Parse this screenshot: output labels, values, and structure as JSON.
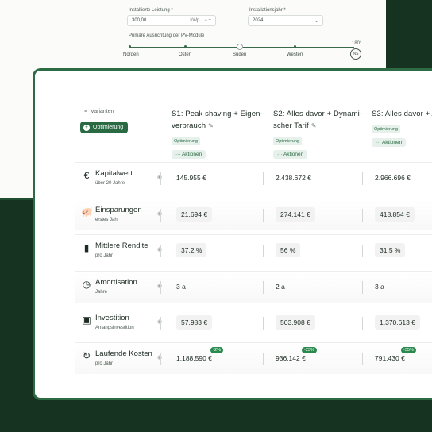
{
  "settings": {
    "power_label": "Installierte Leistung *",
    "power_value": "300,00",
    "power_unit": "kWp",
    "year_label": "Installationsjahr *",
    "year_value": "2024",
    "orientation_label": "Primäre Ausrichtung der PV-Module",
    "slider_value_label": "180°",
    "directions": [
      "Norden",
      "Osten",
      "Süden",
      "Westen"
    ],
    "compass_text": "NS"
  },
  "toolbar": {
    "variants_label": "Varianten",
    "optimize_label": "Optimierung"
  },
  "scenarios": [
    {
      "title": "S1: Peak shaving + Eigenverbrauch",
      "title_l1": "S1: Peak shaving + Eigen-",
      "title_l2": "verbrauch",
      "badge": "Optimierung",
      "actions": "··· Aktionen"
    },
    {
      "title": "S2: Alles davor + Dynamischer Tarif",
      "title_l1": "S2: Alles davor + Dynami-",
      "title_l2": "scher Tarif",
      "badge": "Optimierung",
      "actions": "··· Aktionen"
    },
    {
      "title": "S3: Alles davor + A",
      "title_l1": "S3: Alles davor + A",
      "title_l2": "",
      "badge": "Optimierung",
      "actions": "··· Aktionen"
    }
  ],
  "metrics": [
    {
      "icon": "euro-icon",
      "glyph": "€",
      "title": "Kapitalwert",
      "sub": "über 20 Jahre",
      "values": [
        "145.955 €",
        "2.438.672 €",
        "2.966.696 €"
      ],
      "boxed": false,
      "badges": [
        "",
        "",
        ""
      ]
    },
    {
      "icon": "piggy-bank-icon",
      "glyph": "🐖",
      "title": "Einsparungen",
      "sub": "erstes Jahr",
      "values": [
        "21.694 €",
        "274.141 €",
        "418.854 €"
      ],
      "boxed": true,
      "badges": [
        "",
        "",
        ""
      ]
    },
    {
      "icon": "bar-chart-icon",
      "glyph": "▮",
      "title": "Mittlere Rendite",
      "sub": "pro Jahr",
      "values": [
        "37,2 %",
        "56 %",
        "31,5 %"
      ],
      "boxed": true,
      "badges": [
        "",
        "",
        ""
      ]
    },
    {
      "icon": "clock-icon",
      "glyph": "◷",
      "title": "Amortisation",
      "sub": "Jahre",
      "values": [
        "3 a",
        "2 a",
        "3 a"
      ],
      "boxed": false,
      "badges": [
        "",
        "",
        ""
      ]
    },
    {
      "icon": "banknote-icon",
      "glyph": "▣",
      "title": "Investition",
      "sub": "Anfangsinvestition",
      "values": [
        "57.983 €",
        "503.908 €",
        "1.370.613 €"
      ],
      "boxed": true,
      "badges": [
        "",
        "",
        ""
      ]
    },
    {
      "icon": "refresh-icon",
      "glyph": "↻",
      "title": "Laufende Kosten",
      "sub": "pro Jahr",
      "values": [
        "1.188.590 €",
        "936.142 €",
        "791.430 €"
      ],
      "boxed": false,
      "badges": [
        "-2%",
        "-23%",
        "-35%"
      ]
    }
  ]
}
